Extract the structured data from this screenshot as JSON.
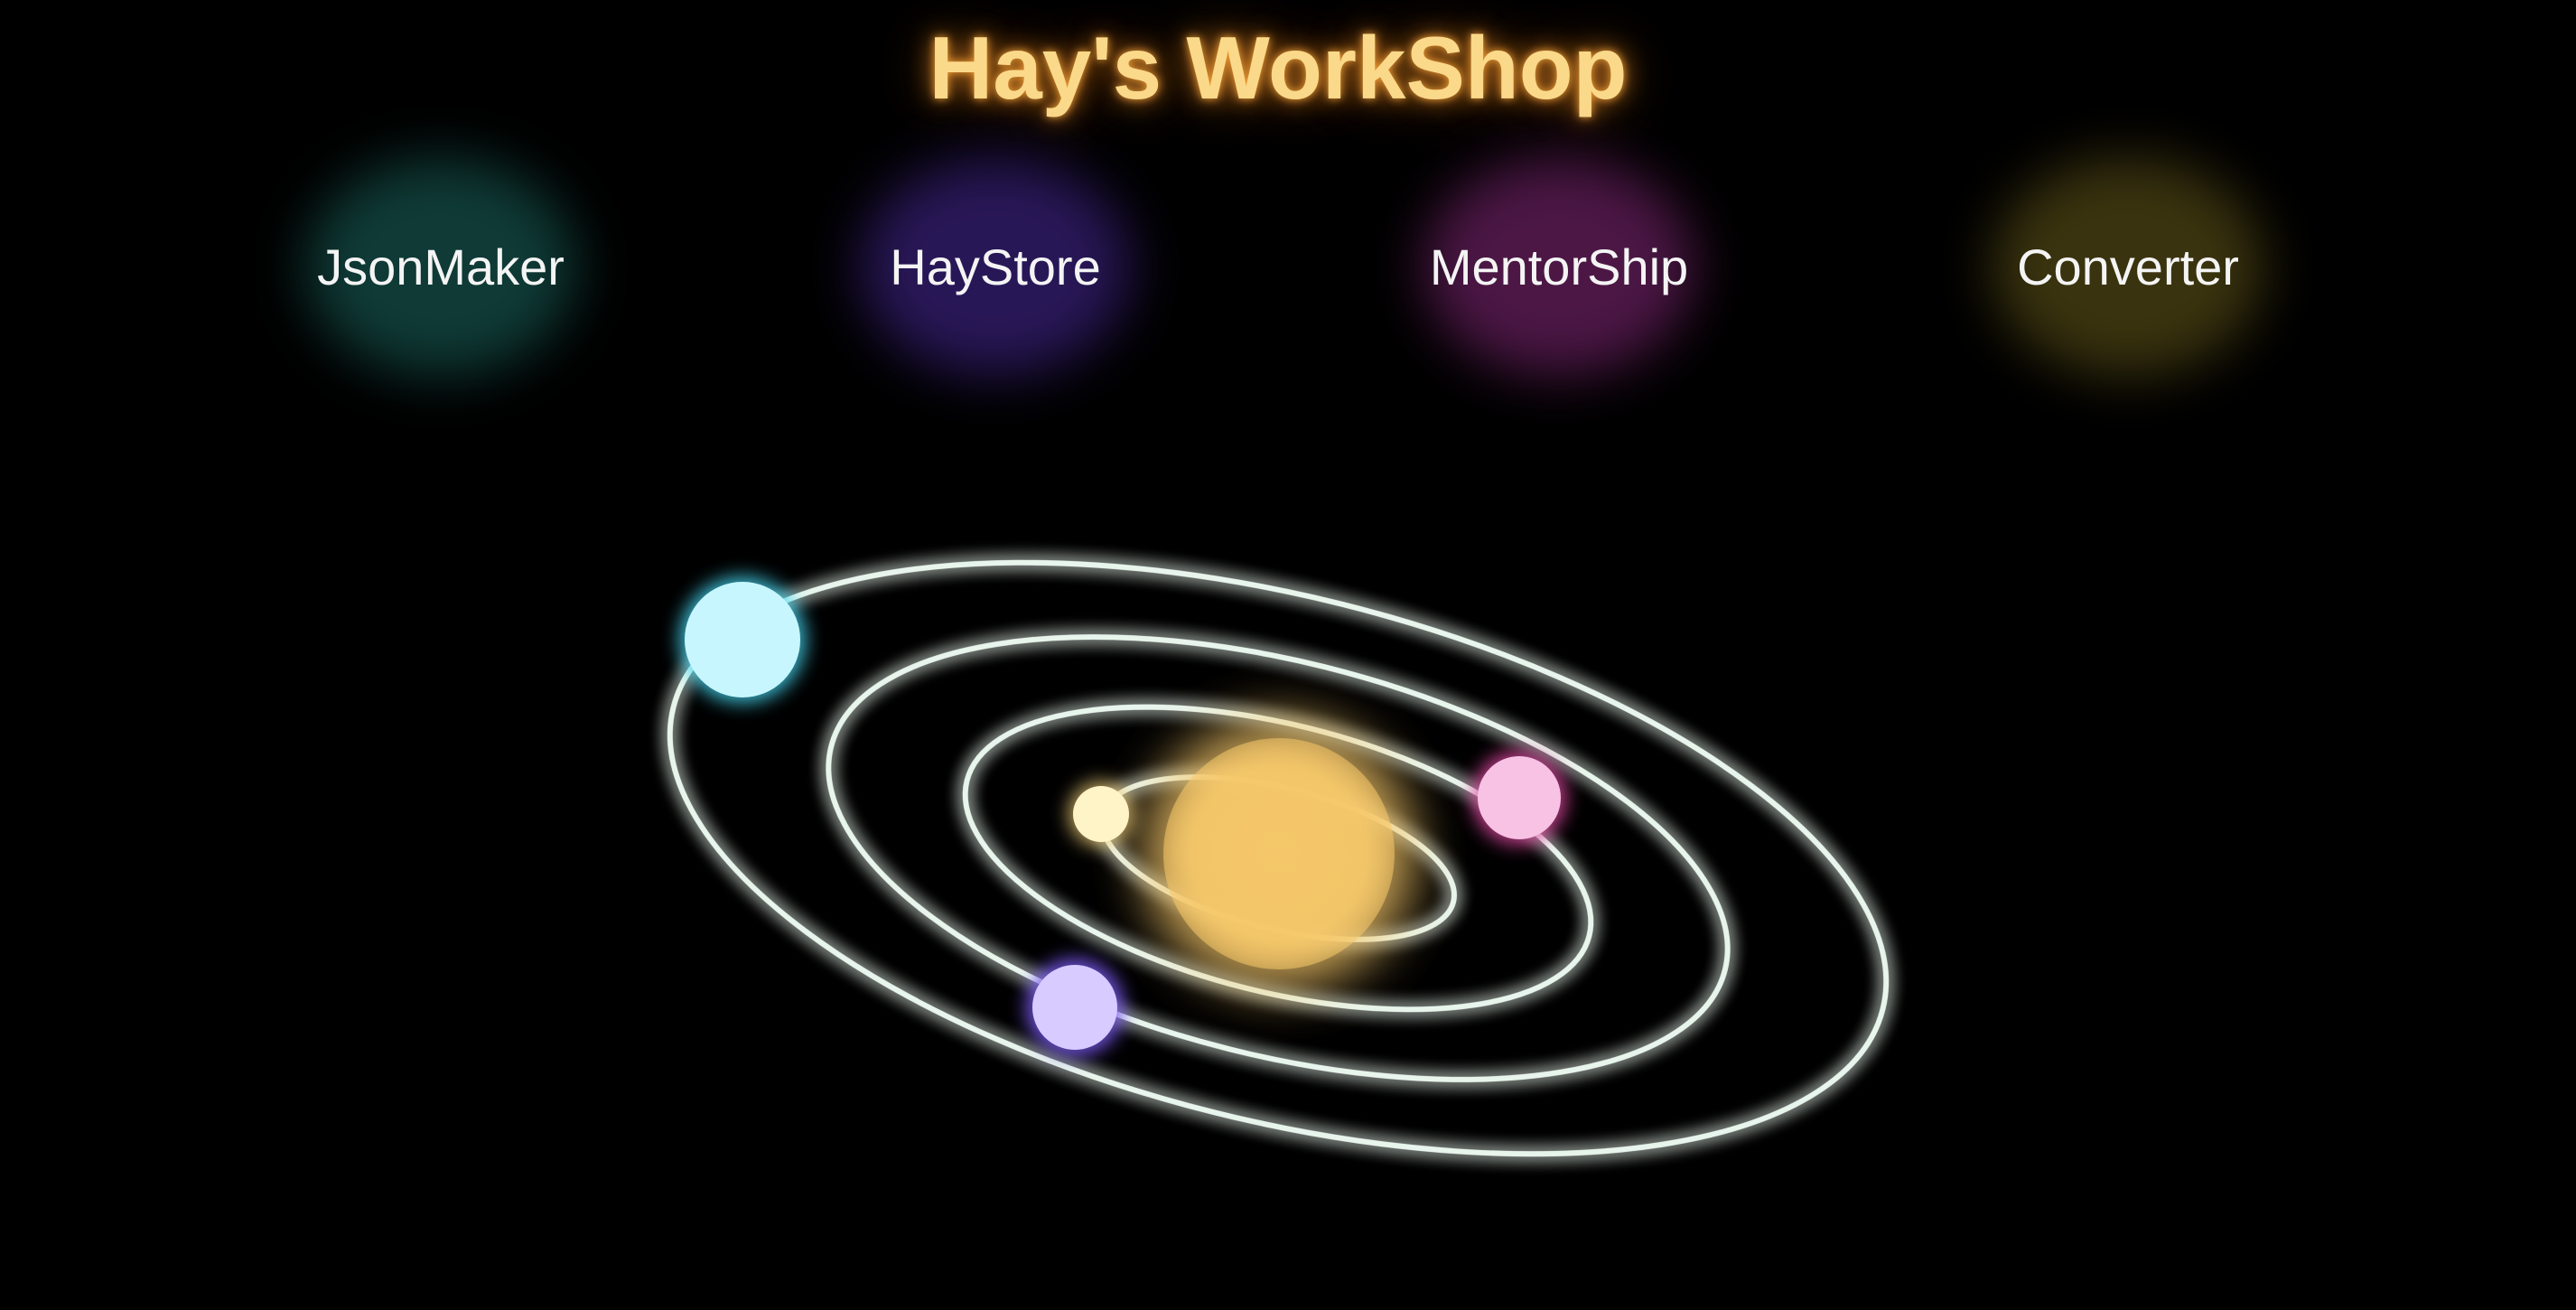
{
  "header": {
    "title": "Hay's WorkShop",
    "title_color": "#fbd98a"
  },
  "nav": {
    "items": [
      {
        "label": "JsonMaker",
        "glow_color": "#1c6b63"
      },
      {
        "label": "HayStore",
        "glow_color": "#4a2a9e"
      },
      {
        "label": "MentorShip",
        "glow_color": "#8a2a7e"
      },
      {
        "label": "Converter",
        "glow_color": "#6b5e1c"
      }
    ]
  },
  "solar_system": {
    "sun_color": "#f6c86a",
    "orbit_color": "#e8f5ec",
    "orbit_glow": "#8fd8b4",
    "planets": [
      {
        "name": "cyan-planet",
        "color": "#c8f6ff",
        "glow": "#46d8f2"
      },
      {
        "name": "cream-planet",
        "color": "#fff3c8",
        "glow": "#f0cf7a"
      },
      {
        "name": "pink-planet",
        "color": "#f7c2e4",
        "glow": "#e04aa2"
      },
      {
        "name": "violet-planet",
        "color": "#d8cbff",
        "glow": "#7a5af0"
      }
    ]
  }
}
